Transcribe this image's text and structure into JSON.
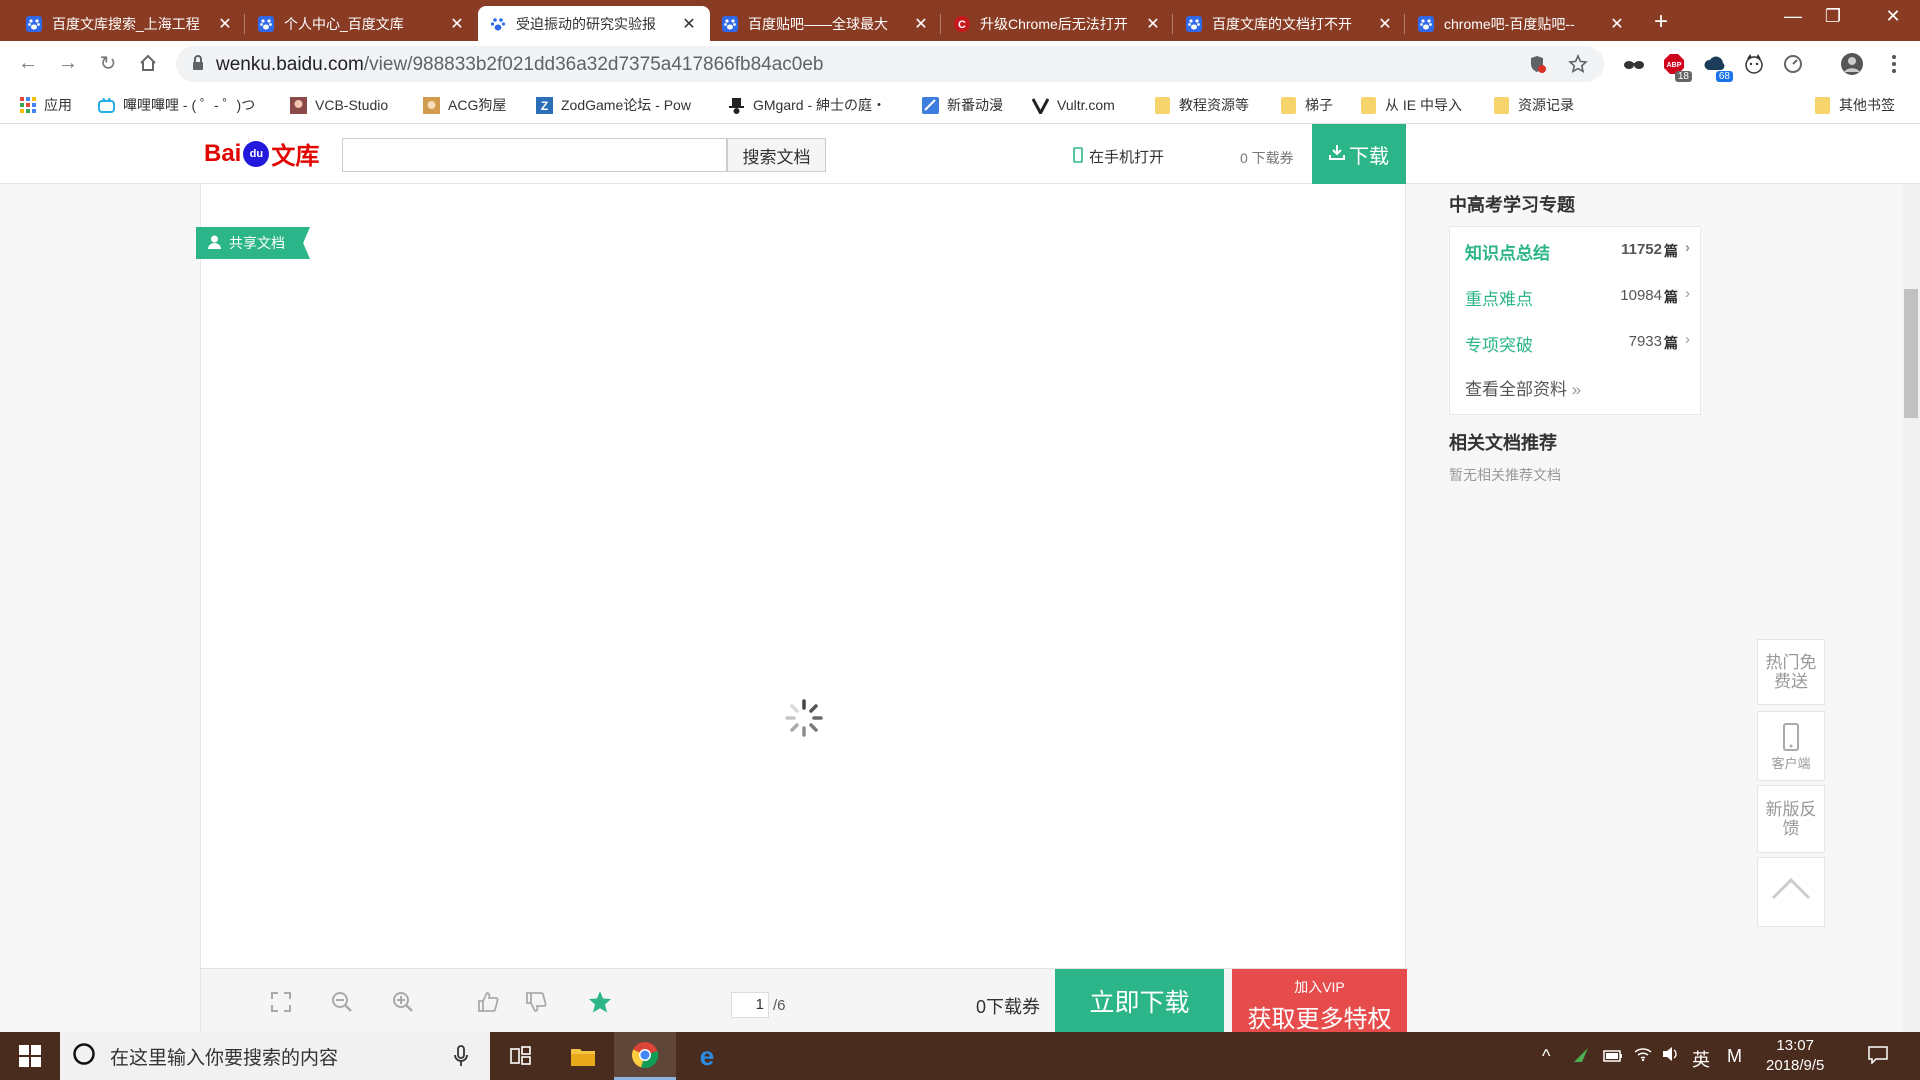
{
  "browser": {
    "tabs": [
      {
        "title": "百度文库搜索_上海工程",
        "active": false
      },
      {
        "title": "个人中心_百度文库",
        "active": false
      },
      {
        "title": "受迫振动的研究实验报",
        "active": true
      },
      {
        "title": "百度贴吧——全球最大",
        "active": false
      },
      {
        "title": "升级Chrome后无法打开",
        "active": false
      },
      {
        "title": "百度文库的文档打不开",
        "active": false
      },
      {
        "title": "chrome吧-百度贴吧--",
        "active": false
      }
    ],
    "url_host": "wenku.baidu.com",
    "url_path": "/view/988833b2f021dd36a32d7375a417866fb84ac0eb",
    "ext_badges": {
      "abp": "18",
      "cloud": "68"
    },
    "bookmarks": [
      "应用",
      "嗶哩嗶哩 - ( ゜- ゜)つ",
      "VCB-Studio",
      "ACG狗屋",
      "ZodGame论坛 - Pow",
      "GMgard - 紳士の庭・",
      "新番动漫",
      "Vultr.com",
      "教程资源等",
      "梯子",
      "从 IE 中导入",
      "资源记录"
    ],
    "other_bookmarks": "其他书签"
  },
  "header": {
    "logo_bai": "Bai",
    "logo_du": "du",
    "logo_wenku": "文库",
    "search_value": "",
    "search_button": "搜索文档",
    "open_on_phone": "在手机打开",
    "coupon": "0 下载券",
    "download": "下载"
  },
  "viewer": {
    "share_tag": "共享文档",
    "page_current": "1",
    "page_total": "/6",
    "coupon": "0下载券",
    "download_now": "立即下载",
    "vip_small": "加入VIP",
    "vip_big": "获取更多特权"
  },
  "sidebar": {
    "topic_title": "中高考学习专题",
    "topics": [
      {
        "label": "知识点总结",
        "count": "11752",
        "unit": "篇"
      },
      {
        "label": "重点难点",
        "count": "10984",
        "unit": "篇"
      },
      {
        "label": "专项突破",
        "count": "7933",
        "unit": "篇"
      }
    ],
    "see_all": "查看全部资料",
    "related_title": "相关文档推荐",
    "related_empty": "暂无相关推荐文档"
  },
  "float_buttons": {
    "hot": "热门免费送",
    "client": "客户端",
    "feedback": "新版反馈"
  },
  "taskbar": {
    "search_placeholder": "在这里输入你要搜索的内容",
    "ime": "英",
    "ime_mode": "M",
    "time": "13:07",
    "date": "2018/9/5"
  }
}
